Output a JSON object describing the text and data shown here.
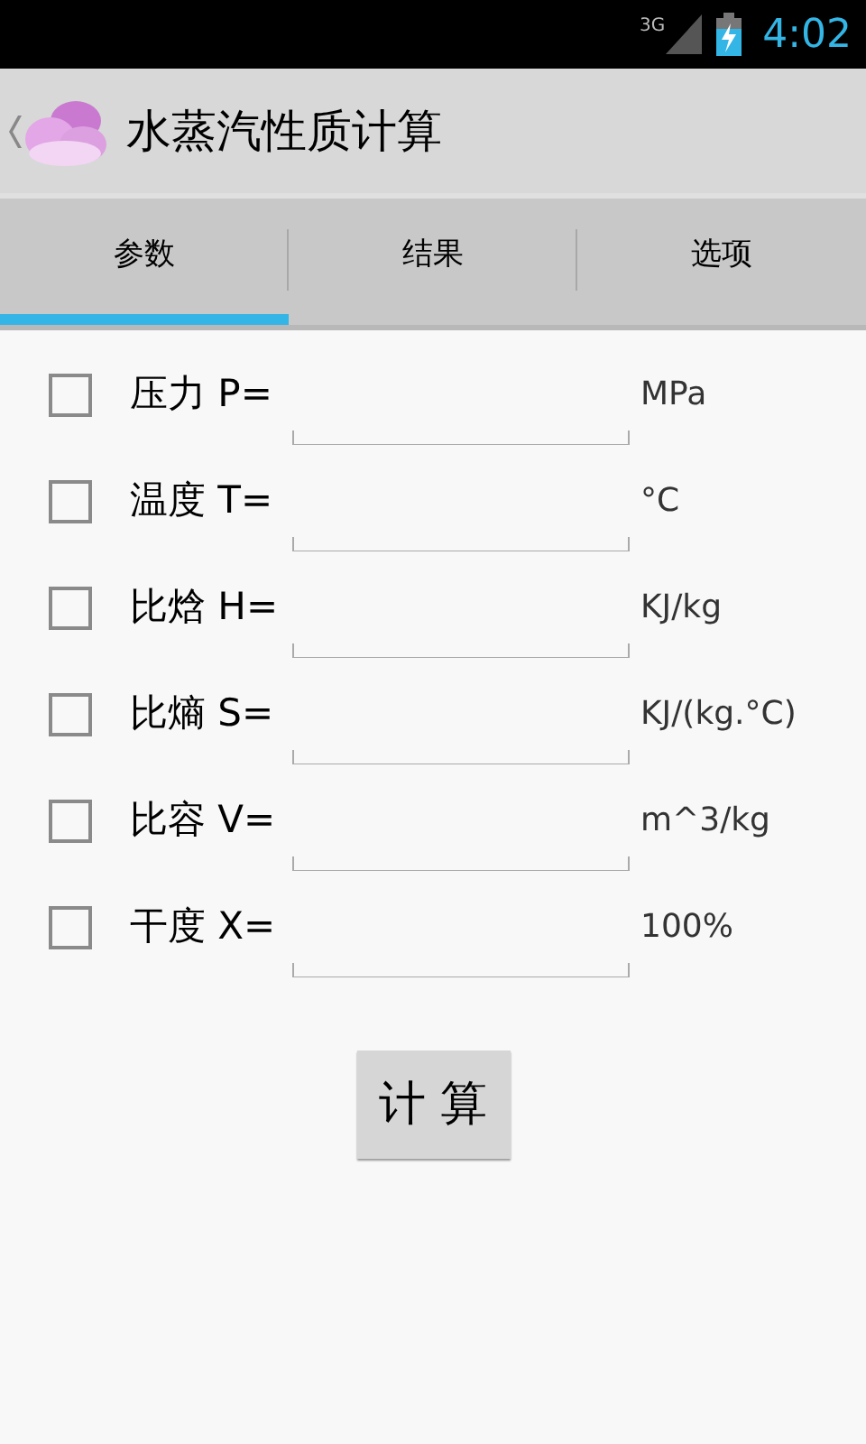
{
  "status_bar": {
    "network": "3G",
    "time": "4:02"
  },
  "action_bar": {
    "title": "水蒸汽性质计算"
  },
  "tabs": [
    {
      "label": "参数",
      "selected": true
    },
    {
      "label": "结果",
      "selected": false
    },
    {
      "label": "选项",
      "selected": false
    }
  ],
  "fields": [
    {
      "label": "压力 P=",
      "checked": false,
      "unit": "MPa"
    },
    {
      "label": "温度 T=",
      "checked": false,
      "unit": "°C"
    },
    {
      "label": "比焓 H=",
      "checked": false,
      "unit": "KJ/kg"
    },
    {
      "label": "比熵 S=",
      "checked": false,
      "unit": "KJ/(kg.°C)"
    },
    {
      "label": "比容 V=",
      "checked": false,
      "unit": "m^3/kg"
    },
    {
      "label": "干度 X=",
      "checked": false,
      "unit": "100%"
    }
  ],
  "button": "计 算"
}
